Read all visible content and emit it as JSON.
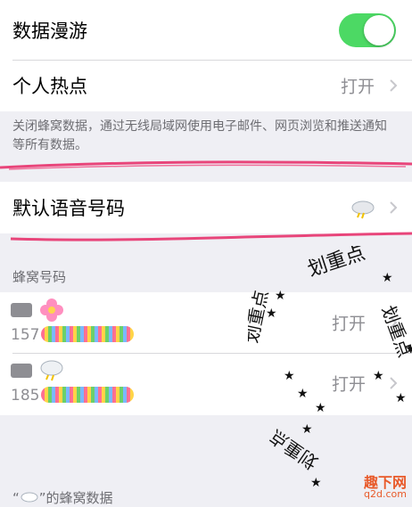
{
  "top_group": {
    "roaming_label": "数据漫游",
    "hotspot_label": "个人热点",
    "hotspot_value": "打开"
  },
  "note": "关闭蜂窝数据，通过无线局域网使用电子邮件、网页浏览和推送通知等所有数据。",
  "voice": {
    "label": "默认语音号码"
  },
  "sim_header": "蜂窝号码",
  "sims": [
    {
      "number": "157",
      "value": "打开",
      "icon": "flower-emoji",
      "color": "#ff8fbf"
    },
    {
      "number": "185",
      "value": "打开",
      "icon": "cloud-emoji",
      "color": "#9fb7c9"
    }
  ],
  "footer_left": "“",
  "footer_right": "”的蜂窝数据",
  "stamp": {
    "words": "划重点"
  },
  "watermark": {
    "site": "q2d.com",
    "brand": "趣下网"
  },
  "colors": {
    "toggle_on": "#4cd964",
    "highlight": "#e8457a"
  }
}
